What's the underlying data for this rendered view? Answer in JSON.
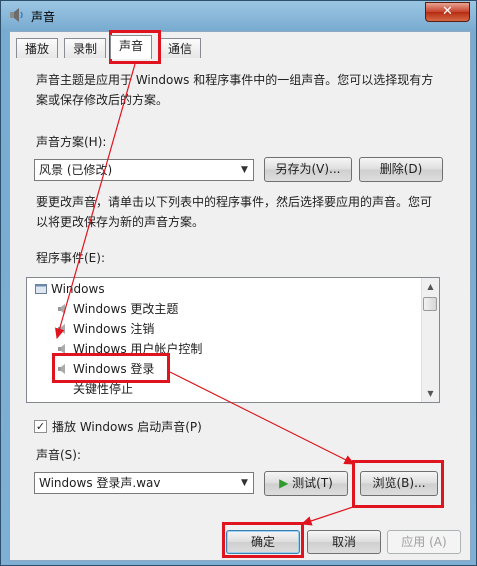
{
  "window": {
    "title": "声音",
    "close_symbol": "✕"
  },
  "tabs": [
    {
      "label": "播放"
    },
    {
      "label": "录制"
    },
    {
      "label": "声音",
      "active": true
    },
    {
      "label": "通信"
    }
  ],
  "sounds_tab": {
    "description": "声音主题是应用于 Windows 和程序事件中的一组声音。您可以选择现有方案或保存修改后的方案。",
    "scheme_label": "声音方案(H):",
    "scheme_value": "风景 (已修改)",
    "save_as_label": "另存为(V)...",
    "delete_label": "删除(D)",
    "instructions": "要更改声音，请单击以下列表中的程序事件，然后选择要应用的声音。您可以将更改保存为新的声音方案。",
    "events_label": "程序事件(E):",
    "events": [
      {
        "label": "Windows"
      },
      {
        "label": "Windows 更改主题"
      },
      {
        "label": "Windows 注销"
      },
      {
        "label": "Windows 用户帐户控制"
      },
      {
        "label": "Windows 登录",
        "selected": true
      },
      {
        "label": "关键性停止"
      }
    ],
    "startup_checkbox_label": "播放 Windows 启动声音(P)",
    "startup_checked": true,
    "sound_label": "声音(S):",
    "sound_value": "Windows 登录声.wav",
    "test_label": "测试(T)",
    "browse_label": "浏览(B)..."
  },
  "footer": {
    "ok_label": "确定",
    "cancel_label": "取消",
    "apply_label": "应用 (A)"
  },
  "colors": {
    "annotation_red": "#e0141f",
    "title_bar": "#78abd0"
  }
}
